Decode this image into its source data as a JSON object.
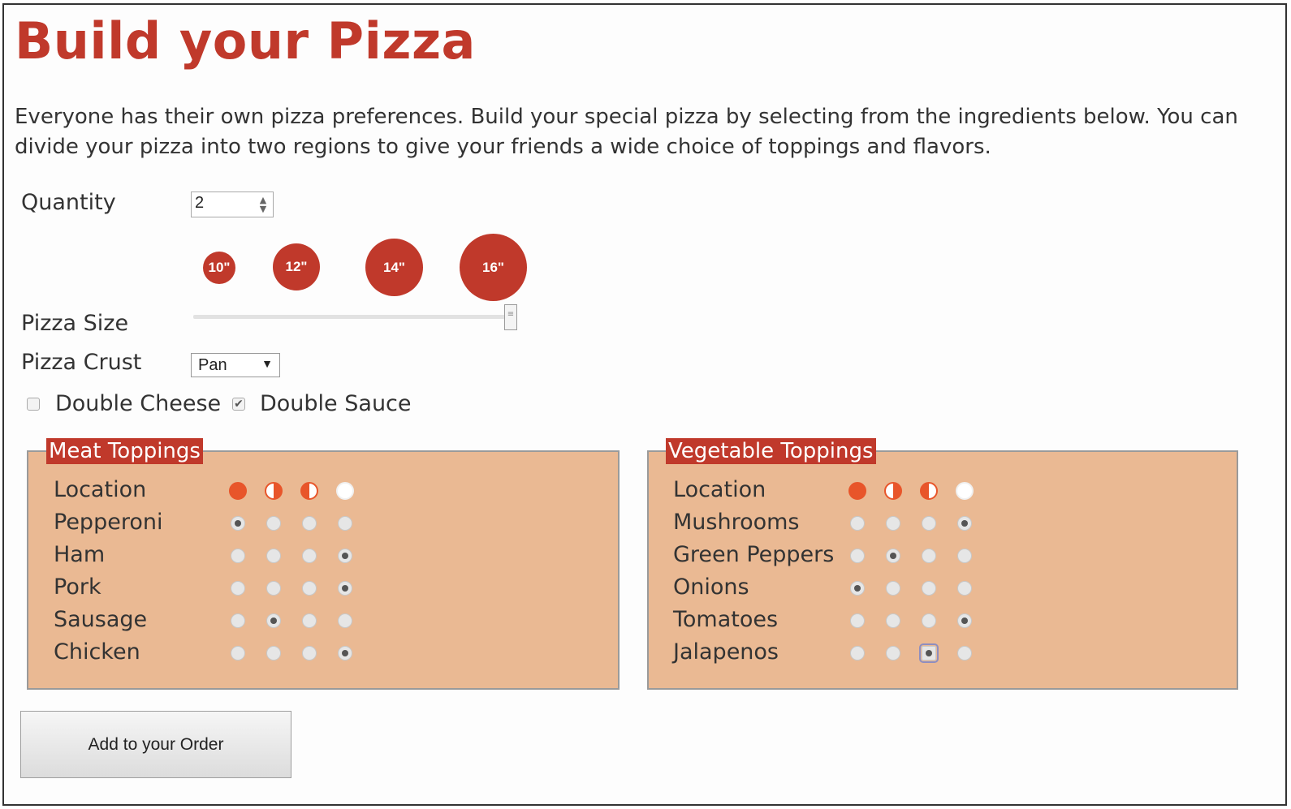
{
  "page": {
    "title": "Build your Pizza",
    "intro": "Everyone has their own pizza preferences. Build your special pizza by selecting from the ingredients below. You can divide your pizza into two regions to give your friends a wide choice of toppings and flavors."
  },
  "quantity": {
    "label": "Quantity",
    "value": "2"
  },
  "size": {
    "label": "Pizza Size",
    "options": [
      "10\"",
      "12\"",
      "14\"",
      "16\""
    ],
    "selected": "16\"",
    "slider_fraction": 1.0
  },
  "crust": {
    "label": "Pizza Crust",
    "value": "Pan"
  },
  "extras": {
    "double_cheese": {
      "label": "Double Cheese",
      "checked": false
    },
    "double_sauce": {
      "label": "Double Sauce",
      "checked": true
    }
  },
  "location_label": "Location",
  "meat": {
    "legend": "Meat Toppings",
    "rows": [
      {
        "name": "Pepperoni",
        "selected": 0
      },
      {
        "name": "Ham",
        "selected": 3
      },
      {
        "name": "Pork",
        "selected": 3
      },
      {
        "name": "Sausage",
        "selected": 1
      },
      {
        "name": "Chicken",
        "selected": 3
      }
    ]
  },
  "veg": {
    "legend": "Vegetable Toppings",
    "rows": [
      {
        "name": "Mushrooms",
        "selected": 3
      },
      {
        "name": "Green Peppers",
        "selected": 1
      },
      {
        "name": "Onions",
        "selected": 0
      },
      {
        "name": "Tomatoes",
        "selected": 3
      },
      {
        "name": "Jalapenos",
        "selected": 2
      }
    ]
  },
  "colors": {
    "accent": "#c0392b",
    "panel": "#eab993",
    "location_orange": "#e8552a"
  },
  "order_button": {
    "label": "Add to your Order"
  }
}
